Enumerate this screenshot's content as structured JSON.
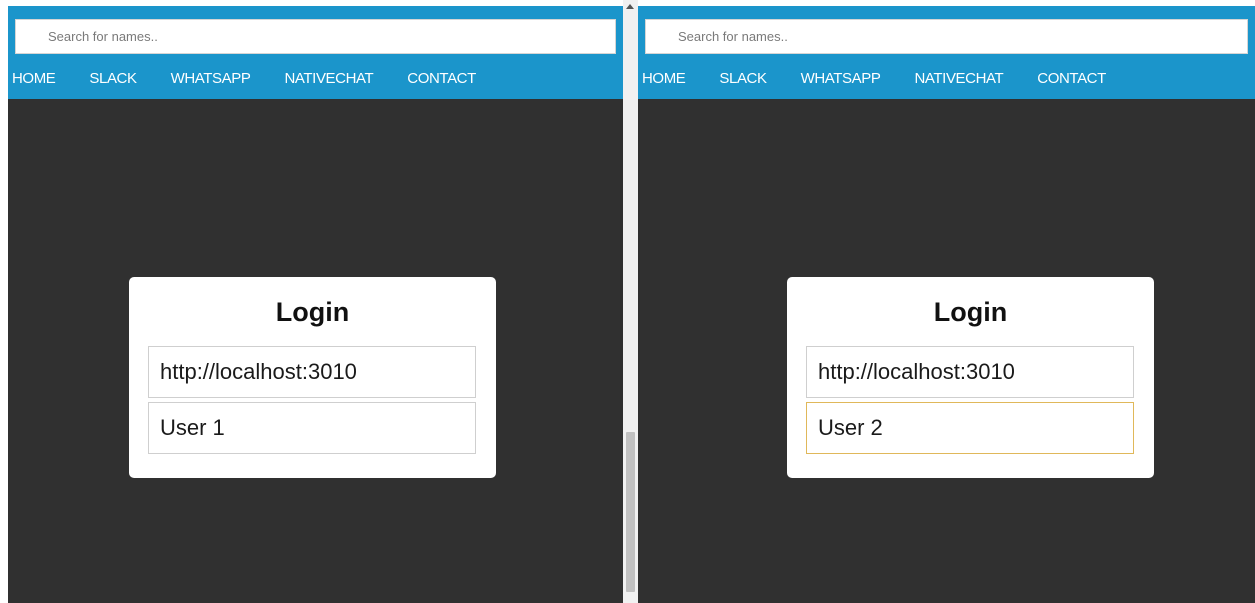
{
  "panes": [
    {
      "search_placeholder": "Search for names..",
      "nav": [
        "HOME",
        "SLACK",
        "WHATSAPP",
        "NATIVECHAT",
        "CONTACT"
      ],
      "login": {
        "title": "Login",
        "server_value": "http://localhost:3010",
        "username_value": "User 1",
        "username_focused": false
      }
    },
    {
      "search_placeholder": "Search for names..",
      "nav": [
        "HOME",
        "SLACK",
        "WHATSAPP",
        "NATIVECHAT",
        "CONTACT"
      ],
      "login": {
        "title": "Login",
        "server_value": "http://localhost:3010",
        "username_value": "User 2",
        "username_focused": true
      }
    }
  ],
  "colors": {
    "header_blue": "#1b95cb",
    "page_background": "#303030",
    "focus_border": "#e0b85a"
  }
}
